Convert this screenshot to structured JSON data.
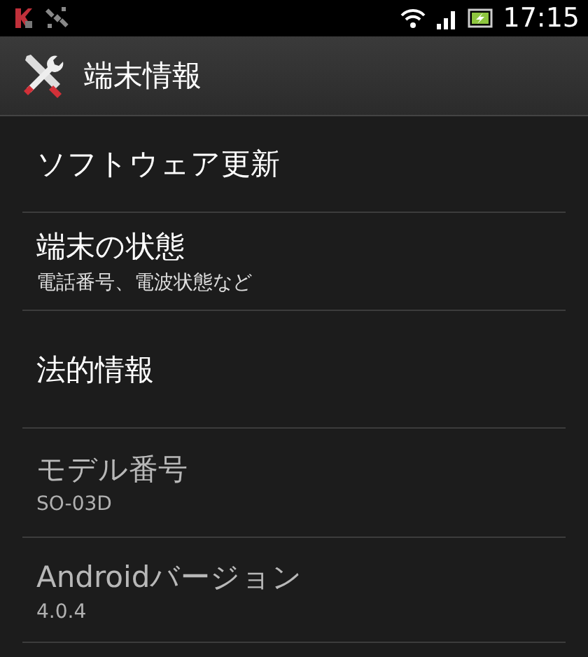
{
  "status_bar": {
    "time": "17:15"
  },
  "action_bar": {
    "title": "端末情報"
  },
  "items": [
    {
      "title": "ソフトウェア更新",
      "disabled": false
    },
    {
      "title": "端末の状態",
      "summary": "電話番号、電波状態など",
      "disabled": false
    },
    {
      "title": "法的情報",
      "disabled": false
    },
    {
      "title": "モデル番号",
      "summary": "SO-03D",
      "disabled": true
    },
    {
      "title": "Androidバージョン",
      "summary": "4.0.4",
      "disabled": true
    }
  ]
}
